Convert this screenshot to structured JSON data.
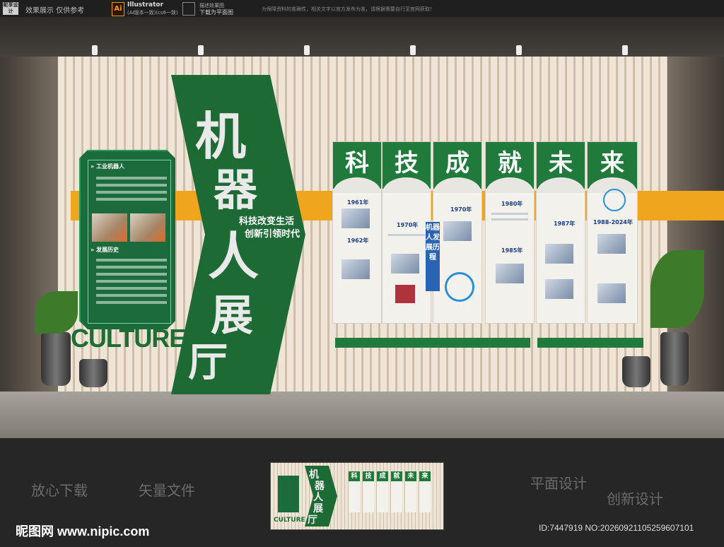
{
  "topbar": {
    "logo": "昵享设计",
    "notice": "效果展示 仅供参考",
    "ai_badge": "Ai",
    "illustrator": "Illustrator",
    "illustrator_sub": "(AI版本一致)(cs6一致)",
    "download_label": "描述效果图",
    "download_sub": "下载为平面图",
    "disclaimer": "为保障资料的准确性，相关文字以官方发布为准，请根据需要自行至官网获取！"
  },
  "panel": {
    "heading1": "» 工业机器人",
    "heading2": "» 发展历史"
  },
  "banner": {
    "chars": [
      "机",
      "器",
      "人",
      "展",
      "厅"
    ],
    "slogan1": "科技改变生活",
    "slogan2": "创新引领时代"
  },
  "culture": "CULTURE",
  "timeline": {
    "heads": [
      "科",
      "技",
      "成",
      "就",
      "未",
      "来"
    ],
    "vertical_label": "机器人发展历程",
    "years": [
      "1961年",
      "1962年",
      "1970年",
      "1970年",
      "1980年",
      "1985年",
      "1987年",
      "1988-2024年"
    ]
  },
  "bottom": {
    "left1": "放心下载",
    "left2": "矢量文件",
    "right1": "平面设计",
    "right2": "创新设计",
    "watermark": "昵图网 www.nipic.com",
    "id_line": "ID:7447919 NO:20260921105259607101"
  },
  "colors": {
    "green": "#1d6a35",
    "orange": "#f0a51e",
    "blue": "#2b63b3"
  }
}
